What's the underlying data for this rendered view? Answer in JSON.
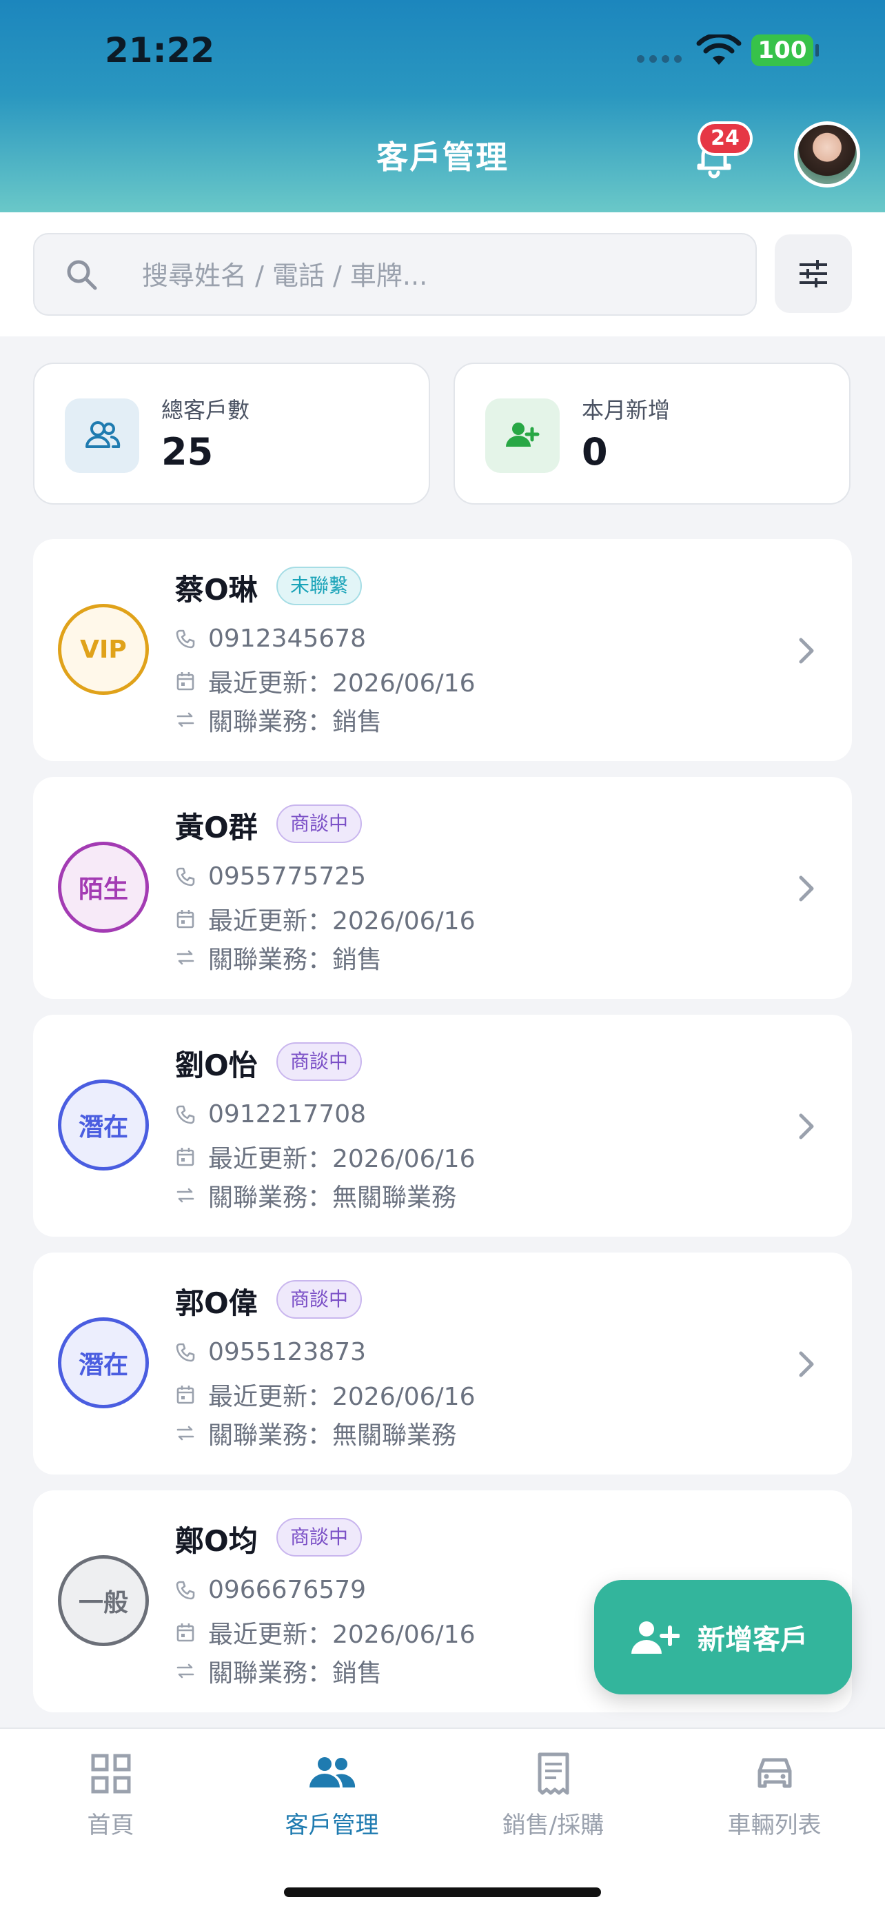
{
  "status_bar": {
    "time": "21:22",
    "battery": "100"
  },
  "header": {
    "title": "客戶管理",
    "notification_count": "24"
  },
  "search": {
    "placeholder": "搜尋姓名 / 電話 / 車牌..."
  },
  "stats": [
    {
      "label": "總客戶數",
      "value": "25",
      "icon": "users-icon"
    },
    {
      "label": "本月新增",
      "value": "0",
      "icon": "user-plus-icon"
    }
  ],
  "customers": [
    {
      "level": "VIP",
      "name": "蔡O琳",
      "status": "未聯繫",
      "phone": "0912345678",
      "updated": "最近更新：2026/06/16",
      "relation": "關聯業務：銷售"
    },
    {
      "level": "陌生",
      "name": "黃O群",
      "status": "商談中",
      "phone": "0955775725",
      "updated": "最近更新：2026/06/16",
      "relation": "關聯業務：銷售"
    },
    {
      "level": "潛在",
      "name": "劉O怡",
      "status": "商談中",
      "phone": "0912217708",
      "updated": "最近更新：2026/06/16",
      "relation": "關聯業務：無關聯業務"
    },
    {
      "level": "潛在",
      "name": "郭O偉",
      "status": "商談中",
      "phone": "0955123873",
      "updated": "最近更新：2026/06/16",
      "relation": "關聯業務：無關聯業務"
    },
    {
      "level": "一般",
      "name": "鄭O均",
      "status": "商談中",
      "phone": "0966676579",
      "updated": "最近更新：2026/06/16",
      "relation": "關聯業務：銷售"
    }
  ],
  "fab": {
    "label": "新增客戶"
  },
  "nav": [
    {
      "label": "首頁",
      "icon": "grid-icon",
      "active": false
    },
    {
      "label": "客戶管理",
      "icon": "users-icon",
      "active": true
    },
    {
      "label": "銷售/採購",
      "icon": "receipt-icon",
      "active": false
    },
    {
      "label": "車輛列表",
      "icon": "car-icon",
      "active": false
    }
  ],
  "colors": {
    "vip": "#e0a21a",
    "stranger": "#a33bb3",
    "potential": "#4a5de0",
    "general": "#6b6f78",
    "tag_uncontacted": "#1aa3b8",
    "tag_negotiating": "#7a4fc6",
    "accent": "#1f7bb0",
    "fab": "#33b59c"
  }
}
